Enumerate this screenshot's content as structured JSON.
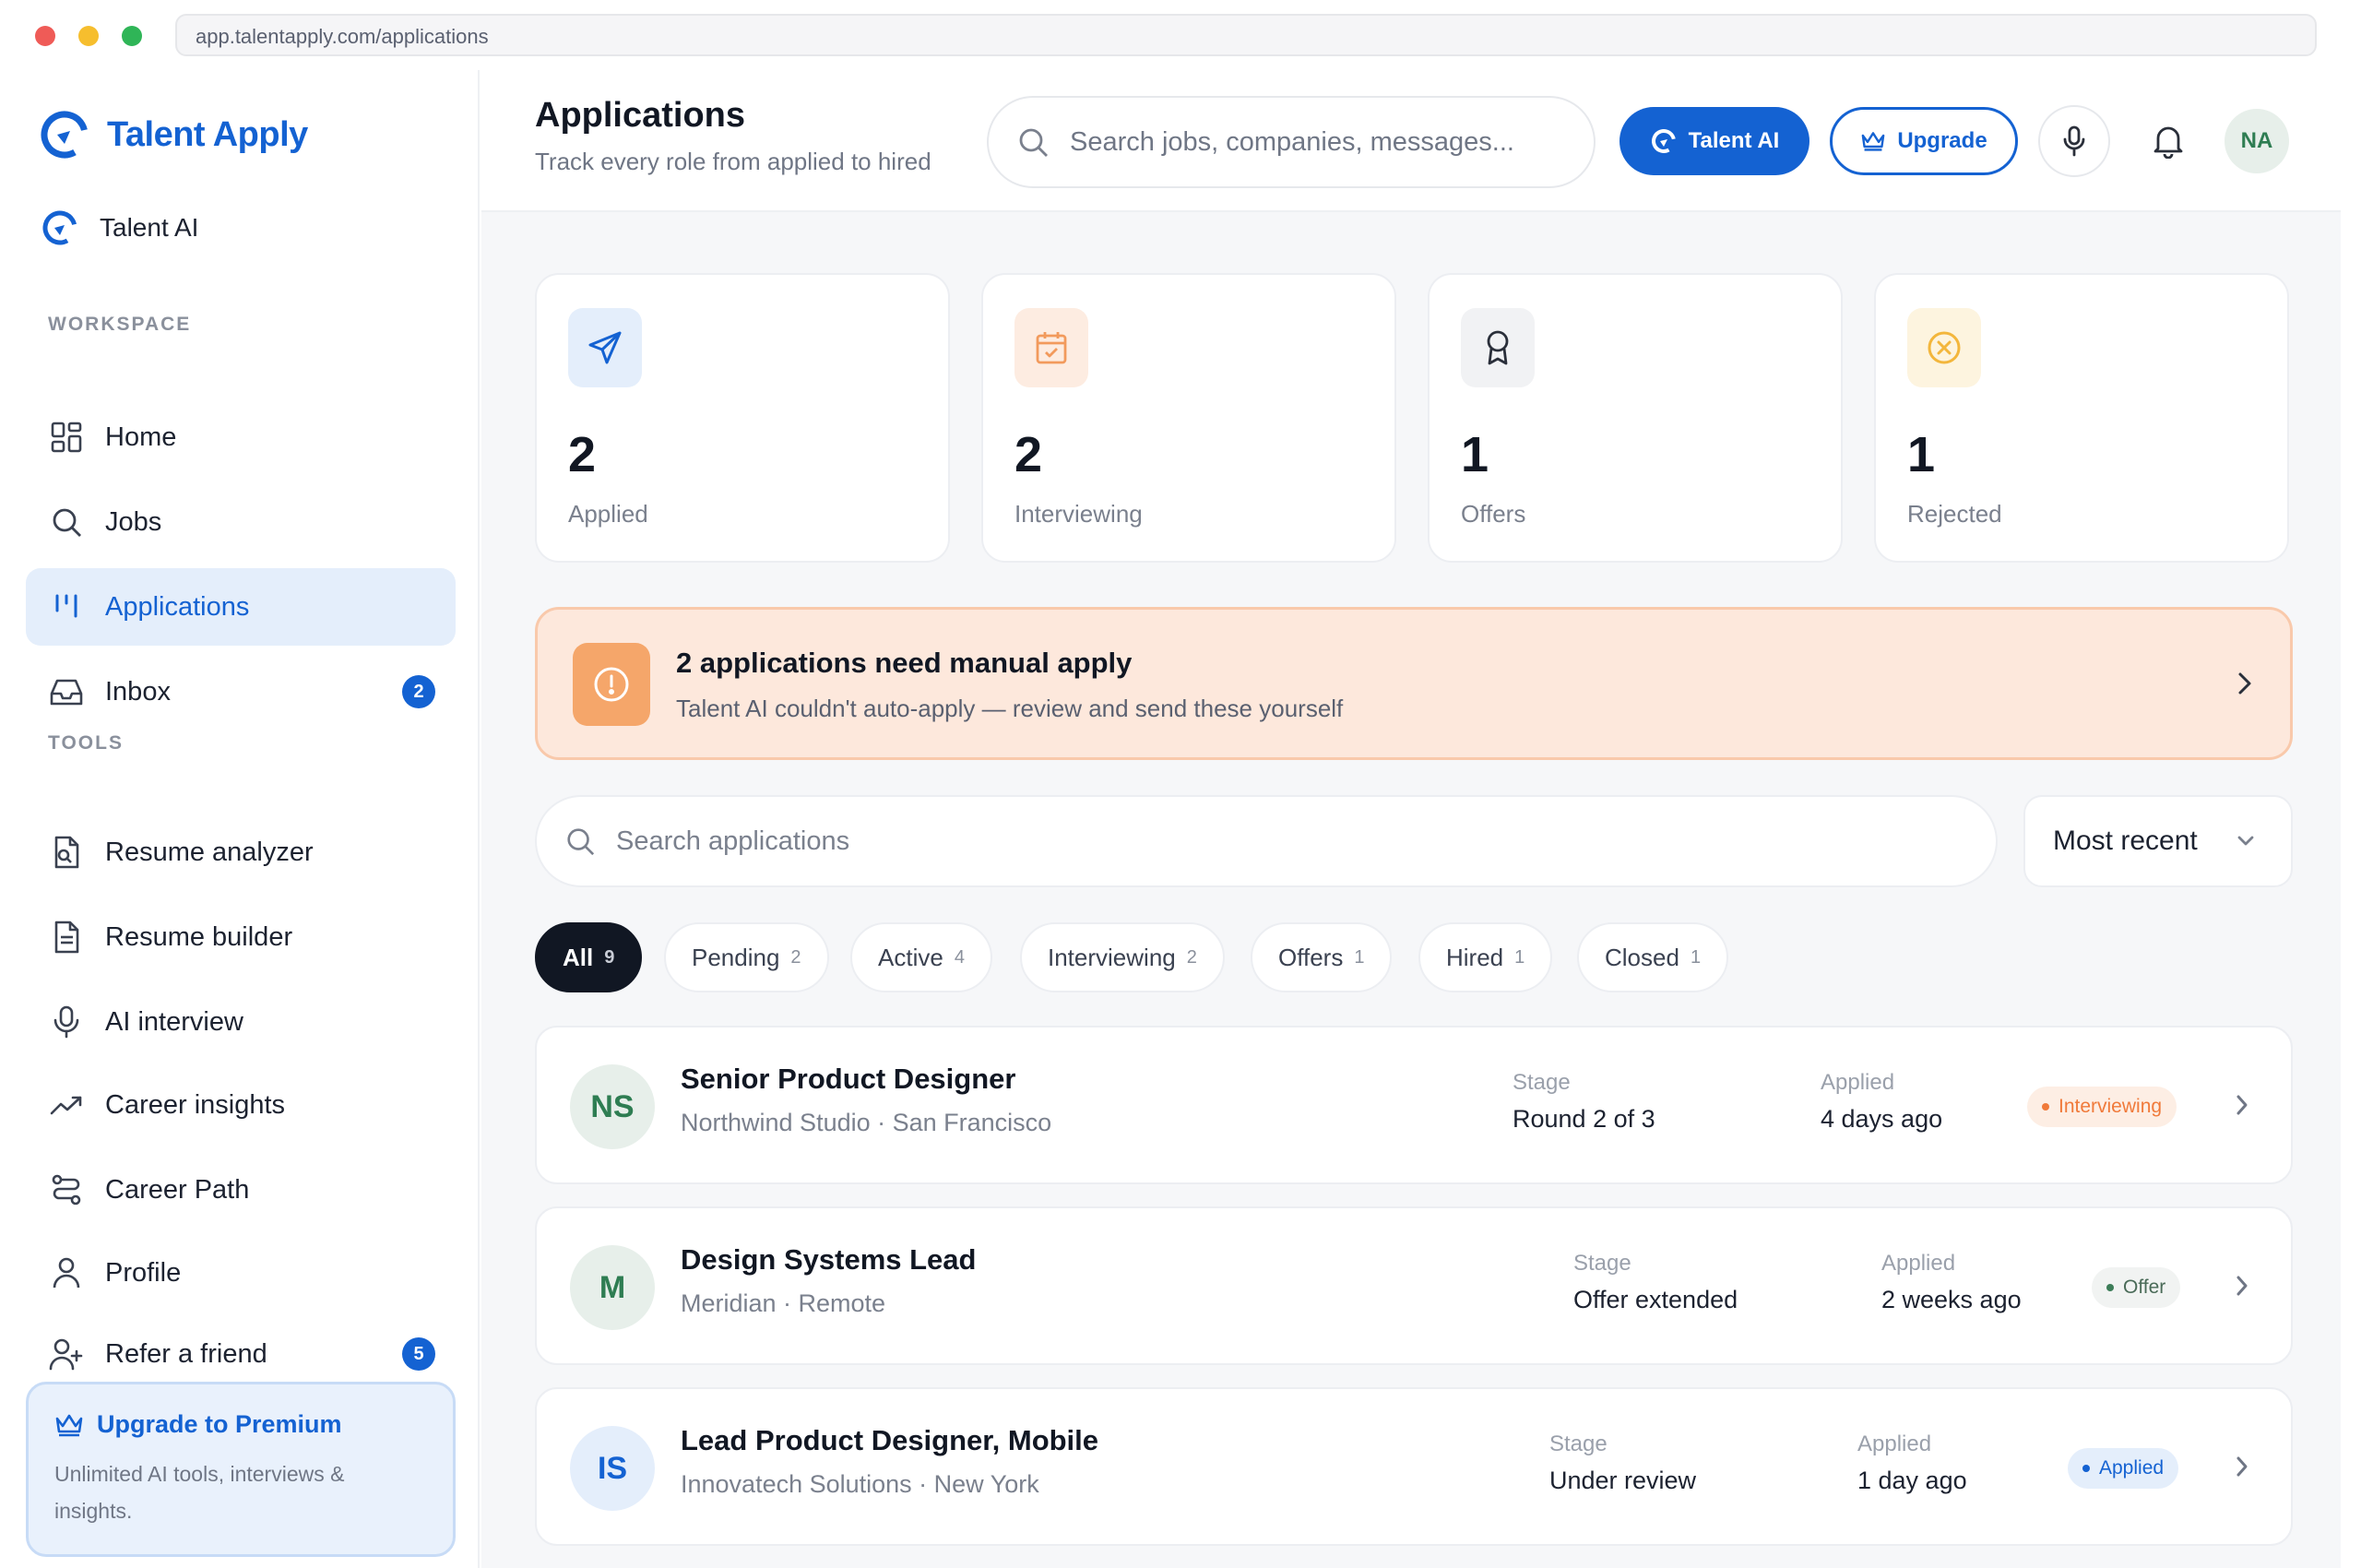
{
  "browser": {
    "url": "app.talentapply.com/applications"
  },
  "sidebar": {
    "brand": "Talent Apply",
    "talent_ai": "Talent AI",
    "sections": {
      "workspace": "WORKSPACE",
      "tools": "TOOLS"
    },
    "workspace_items": [
      {
        "label": "Home",
        "icon": "grid-icon"
      },
      {
        "label": "Jobs",
        "icon": "search-icon"
      },
      {
        "label": "Applications",
        "icon": "bars-icon",
        "active": true
      },
      {
        "label": "Inbox",
        "icon": "inbox-icon",
        "badge": "2"
      }
    ],
    "tool_items": [
      {
        "label": "Resume analyzer",
        "icon": "doc-search-icon"
      },
      {
        "label": "Resume builder",
        "icon": "doc-icon"
      },
      {
        "label": "AI interview",
        "icon": "mic-icon"
      },
      {
        "label": "Career insights",
        "icon": "trend-icon"
      },
      {
        "label": "Career Path",
        "icon": "path-icon"
      },
      {
        "label": "Profile",
        "icon": "user-icon"
      },
      {
        "label": "Refer a friend",
        "icon": "user-plus-icon",
        "badge": "5"
      }
    ],
    "upgrade": {
      "title": "Upgrade to Premium",
      "subtitle": "Unlimited AI tools, interviews & insights."
    }
  },
  "header": {
    "title": "Applications",
    "subtitle": "Track every role from applied to hired",
    "search_placeholder": "Search jobs, companies, messages...",
    "talent_ai_button": "Talent AI",
    "upgrade_button": "Upgrade",
    "avatar_initials": "NA"
  },
  "stats": [
    {
      "value": "2",
      "label": "Applied",
      "icon": "send-icon",
      "color": "#1462d2",
      "bg": "#e4eefb"
    },
    {
      "value": "2",
      "label": "Interviewing",
      "icon": "calendar-icon",
      "color": "#f29a5c",
      "bg": "#fdece1"
    },
    {
      "value": "1",
      "label": "Offers",
      "icon": "award-icon",
      "color": "#2a2f3a",
      "bg": "#f1f2f4"
    },
    {
      "value": "1",
      "label": "Rejected",
      "icon": "x-circle-icon",
      "color": "#f3b63c",
      "bg": "#fdf4df"
    }
  ],
  "alert": {
    "title": "2 applications need manual apply",
    "subtitle": "Talent AI couldn't auto-apply — review and send these yourself"
  },
  "list": {
    "search_placeholder": "Search applications",
    "sort_value": "Most recent",
    "filters": [
      {
        "label": "All",
        "count": "9",
        "active": true
      },
      {
        "label": "Pending",
        "count": "2"
      },
      {
        "label": "Active",
        "count": "4"
      },
      {
        "label": "Interviewing",
        "count": "2"
      },
      {
        "label": "Offers",
        "count": "1"
      },
      {
        "label": "Hired",
        "count": "1"
      },
      {
        "label": "Closed",
        "count": "1"
      }
    ],
    "meta_labels": {
      "stage": "Stage",
      "applied": "Applied"
    },
    "rows": [
      {
        "initials": "NS",
        "title": "Senior Product Designer",
        "subtitle": "Northwind Studio · San Francisco",
        "stage": "Round 2 of 3",
        "applied": "4 days ago",
        "status": "Interviewing",
        "status_color": "#f07a3a",
        "status_bg": "#fdeee4",
        "avatar_color": "#2e7d52",
        "avatar_bg": "#e7efea"
      },
      {
        "initials": "M",
        "title": "Design Systems Lead",
        "subtitle": "Meridian · Remote",
        "stage": "Offer extended",
        "applied": "2 weeks ago",
        "status": "Offer",
        "status_color": "#4a6b58",
        "status_bg": "#f1f3f2",
        "avatar_color": "#2e7d52",
        "avatar_bg": "#e7efea"
      },
      {
        "initials": "IS",
        "title": "Lead Product Designer, Mobile",
        "subtitle": "Innovatech Solutions · New York",
        "stage": "Under review",
        "applied": "1 day ago",
        "status": "Applied",
        "status_color": "#1462d2",
        "status_bg": "#e4eefb",
        "avatar_color": "#1462d2",
        "avatar_bg": "#e4eefb"
      }
    ]
  }
}
